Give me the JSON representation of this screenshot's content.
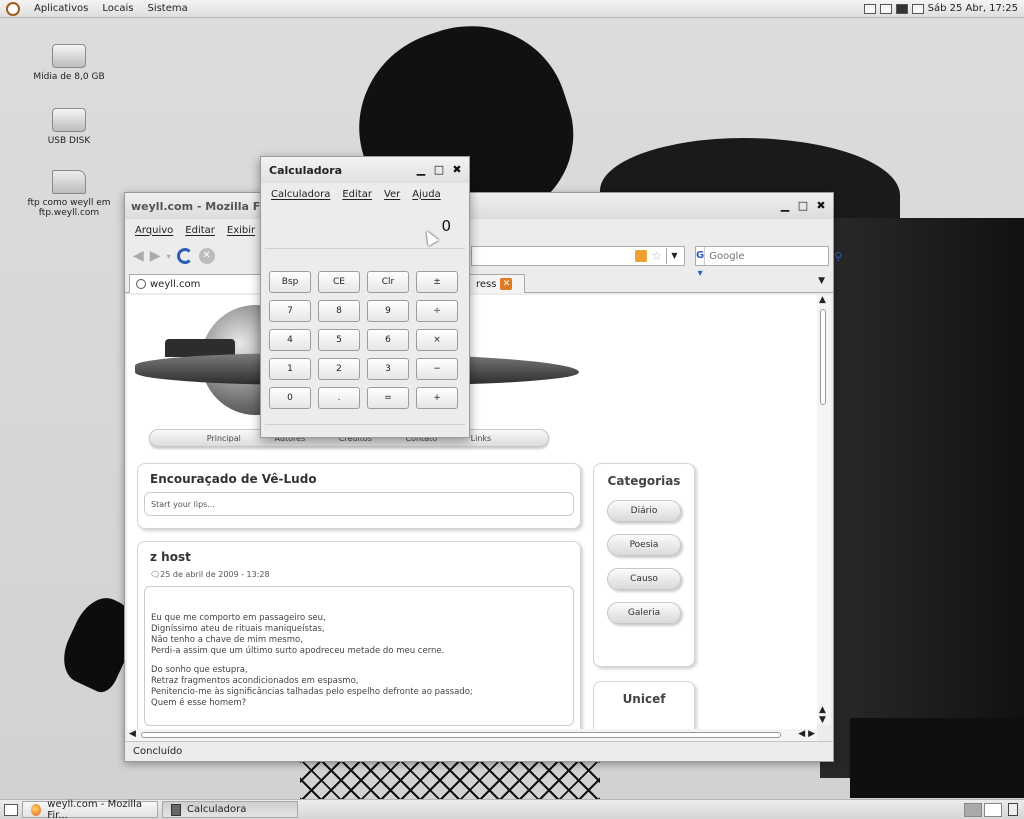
{
  "top_panel": {
    "menus": [
      "Aplicativos",
      "Locais",
      "Sistema"
    ],
    "clock": "Sáb 25 Abr, 17:25"
  },
  "desktop_icons": [
    {
      "label": "Mídia de 8,0 GB",
      "icon": "drive-icon"
    },
    {
      "label": "USB DISK",
      "icon": "usb-drive-icon"
    },
    {
      "label": "ftp como weyll em ftp.weyll.com",
      "icon": "network-folder-icon"
    }
  ],
  "firefox": {
    "title": "weyll.com - Mozilla Fir",
    "menus": [
      "Arquivo",
      "Editar",
      "Exibir"
    ],
    "search_placeholder": "Google",
    "tabs": [
      {
        "label": "weyll.com"
      },
      {
        "label": "ress"
      }
    ],
    "status": "Concluído",
    "site": {
      "nav": [
        "Principal",
        "Autores",
        "Créditos",
        "Contato",
        "Links"
      ],
      "blog_title": "Encouraçado de Vê-Ludo",
      "blog_tagline": "Start your lips...",
      "post": {
        "title": "z host",
        "date": "25 de abril de 2009 - 13:28",
        "stanza1": [
          "Eu que me comporto em passageiro seu,",
          "Digníssimo ateu de rituais maniqueístas,",
          "Não tenho a chave de mim mesmo,",
          "Perdi-a assim que um último surto apodreceu metade do meu cerne."
        ],
        "stanza2": [
          "Do sonho que estupra,",
          "Retraz fragmentos acondicionados em espasmo,",
          "Penitencio-me às significâncias talhadas pelo espelho defronte ao passado;",
          "Quem é esse homem?"
        ]
      },
      "categories_title": "Categorias",
      "categories": [
        "Diário",
        "Poesia",
        "Causo",
        "Galeria"
      ],
      "unicef_title": "Unicef"
    }
  },
  "calculator": {
    "title": "Calculadora",
    "menus": [
      "Calculadora",
      "Editar",
      "Ver",
      "Ajuda"
    ],
    "display": "0",
    "keys": [
      "Bsp",
      "CE",
      "Clr",
      "±",
      "7",
      "8",
      "9",
      "÷",
      "4",
      "5",
      "6",
      "×",
      "1",
      "2",
      "3",
      "−",
      "0",
      ".",
      "=",
      "+"
    ]
  },
  "taskbar": {
    "tasks": [
      {
        "label": "weyll.com - Mozilla Fir...",
        "icon": "firefox-icon"
      },
      {
        "label": "Calculadora",
        "icon": "calculator-icon"
      }
    ]
  }
}
